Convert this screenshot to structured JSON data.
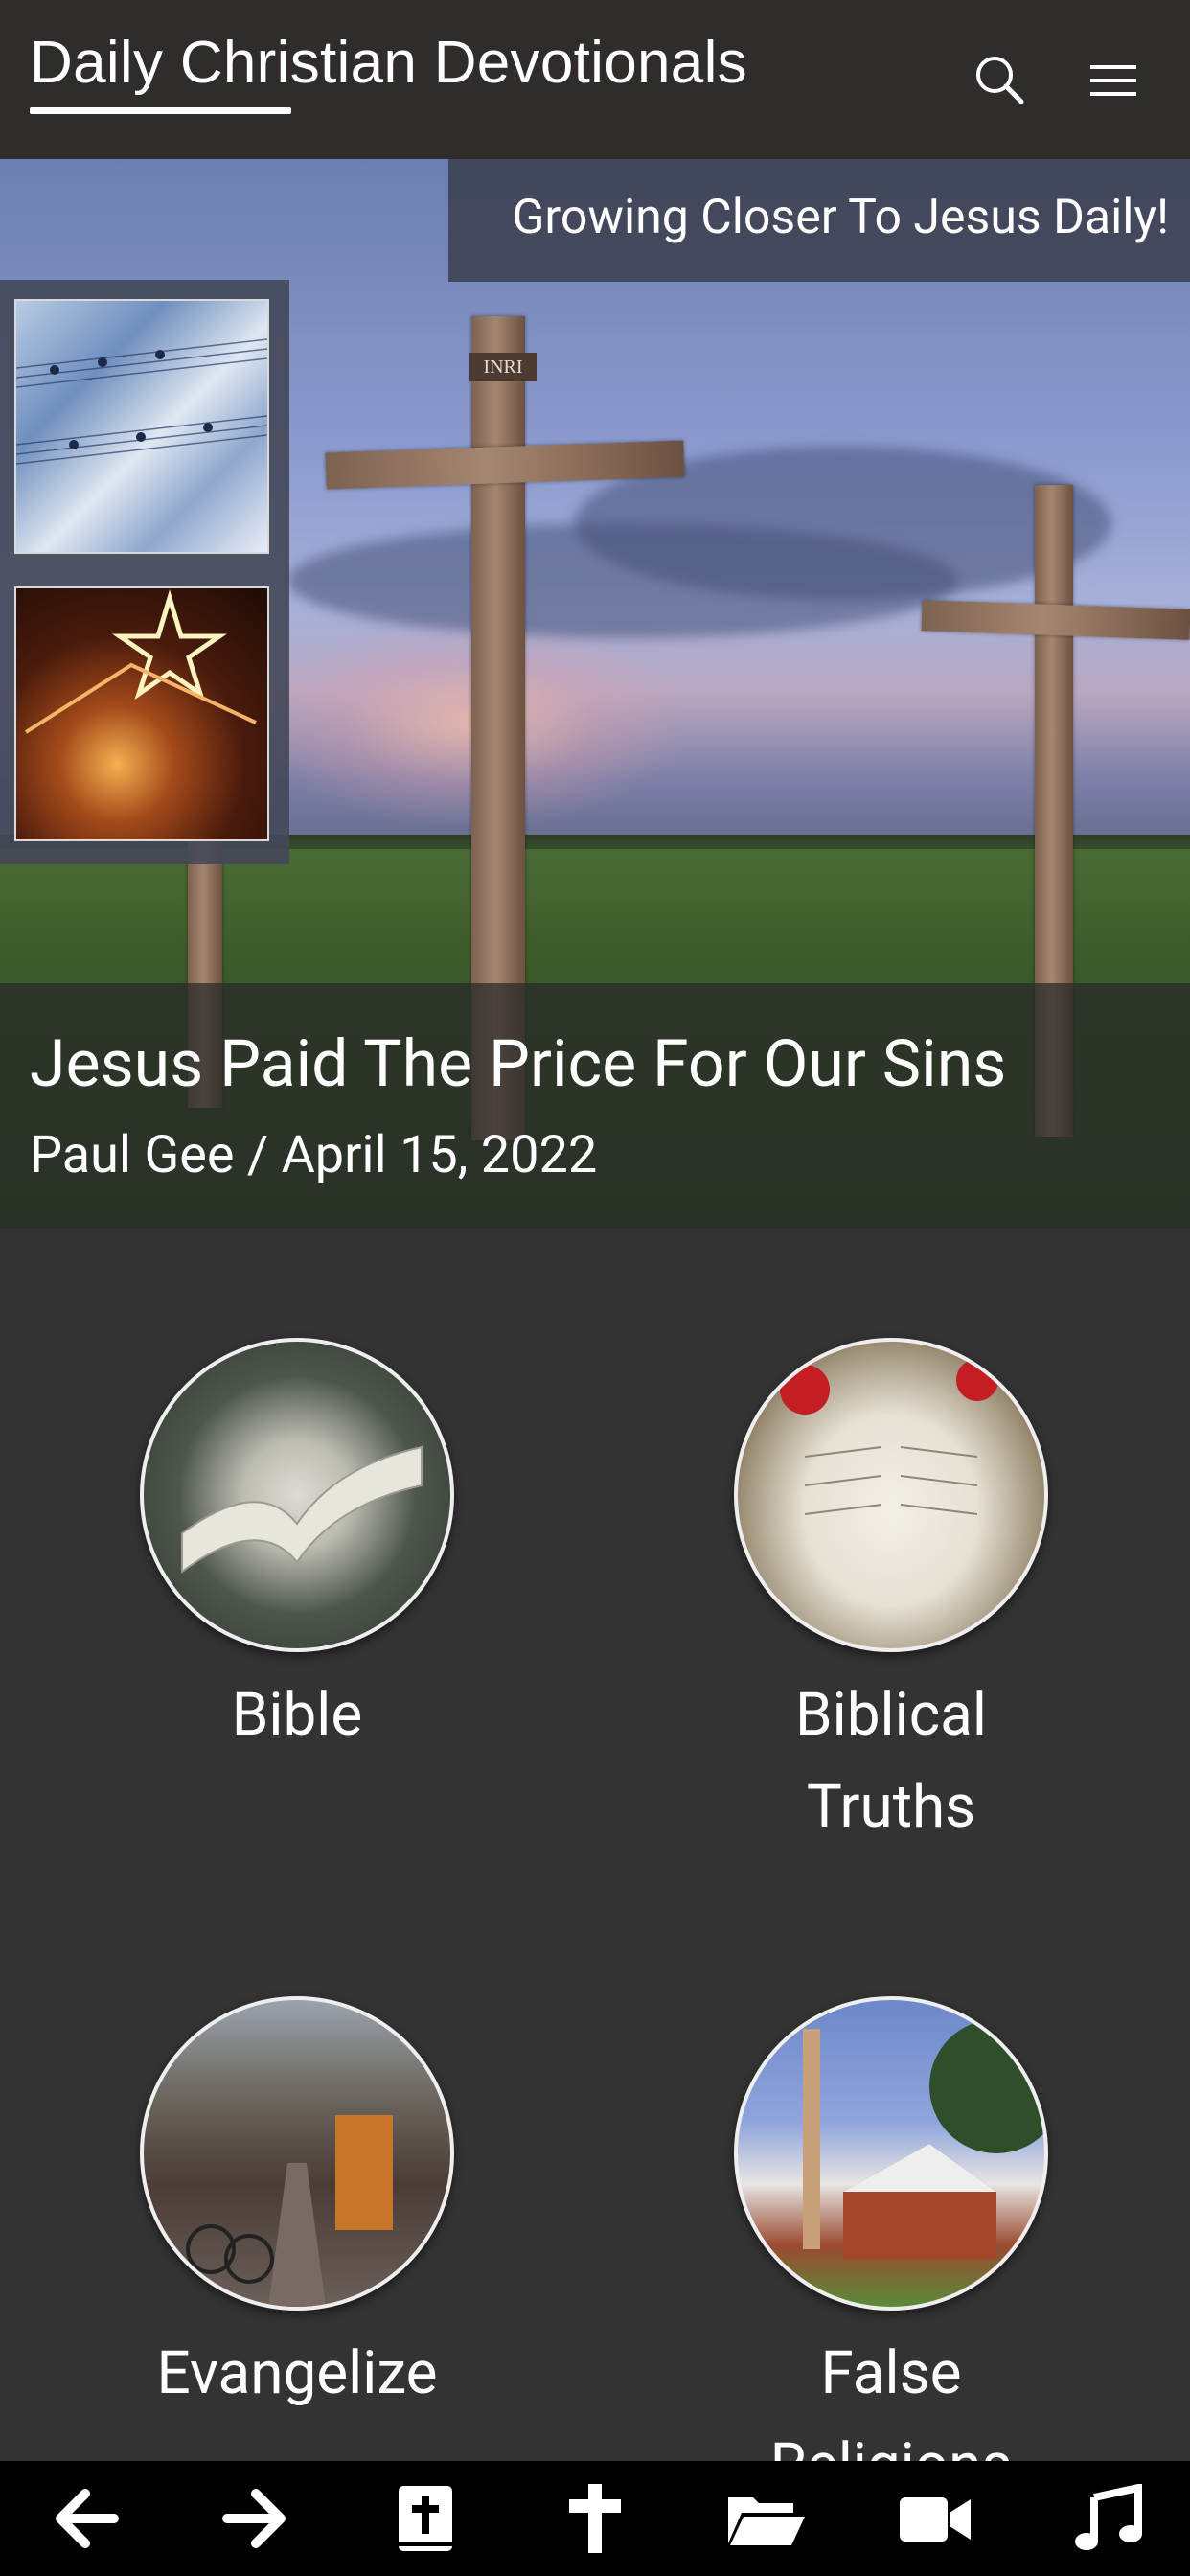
{
  "header": {
    "site_title": "Daily Christian Devotionals",
    "search_icon": "search-icon",
    "menu_icon": "hamburger-menu-icon"
  },
  "hero": {
    "tagline": "Growing Closer To Jesus Daily!",
    "cross_sign": "INRI",
    "post_title": "Jesus Paid The Price For Our Sins",
    "post_meta": "Paul Gee / April 15, 2022"
  },
  "categories": [
    {
      "label": "Bible"
    },
    {
      "label": "Biblical Truths"
    },
    {
      "label": "Evangelize"
    },
    {
      "label": "False Religions"
    }
  ],
  "bottom_nav": {
    "items": [
      {
        "icon": "arrow-left-icon"
      },
      {
        "icon": "arrow-right-icon"
      },
      {
        "icon": "bible-icon"
      },
      {
        "icon": "cross-icon"
      },
      {
        "icon": "folder-open-icon"
      },
      {
        "icon": "video-camera-icon"
      },
      {
        "icon": "music-note-icon"
      }
    ]
  },
  "colors": {
    "header_bg": "#2f2c2b",
    "page_bg": "#333333",
    "nav_bg": "#000000"
  }
}
